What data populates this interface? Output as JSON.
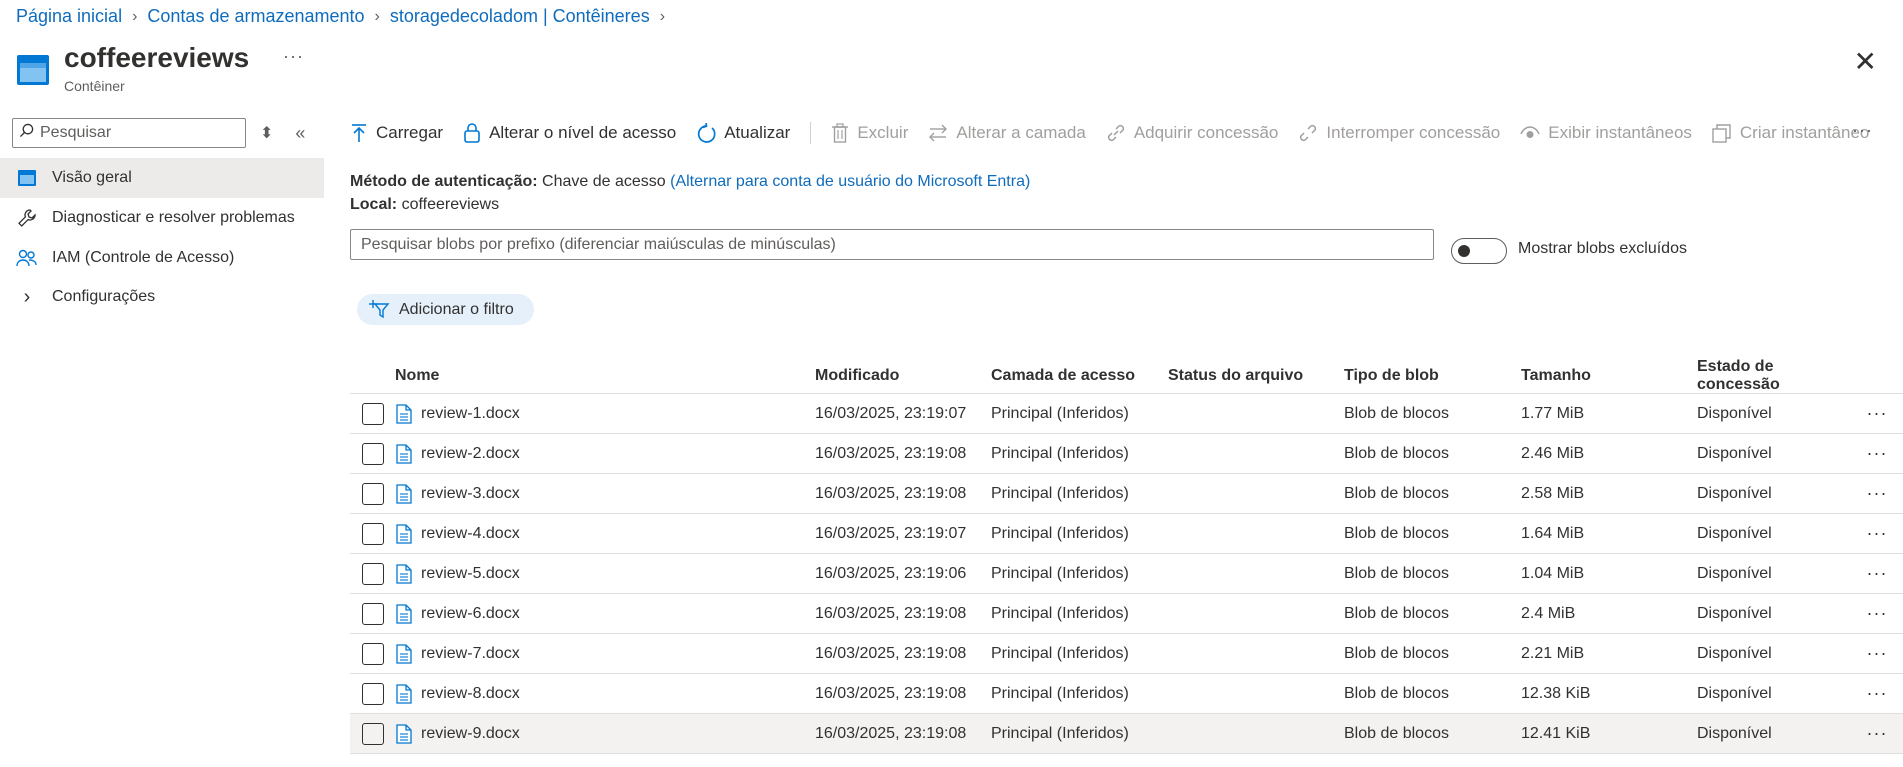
{
  "breadcrumb": [
    "Página inicial",
    "Contas de armazenamento",
    "storagedecoladom | Contêineres"
  ],
  "title": "coffeereviews",
  "subtitle": "Contêiner",
  "sidebar": {
    "search_placeholder": "Pesquisar",
    "items": [
      {
        "label": "Visão geral",
        "icon": "container-icon",
        "active": true
      },
      {
        "label": "Diagnosticar e resolver problemas",
        "icon": "wrench-icon"
      },
      {
        "label": "IAM (Controle de Acesso)",
        "icon": "people-icon"
      },
      {
        "label": "Configurações",
        "icon": "chevron-right-icon"
      }
    ]
  },
  "toolbar": {
    "upload": "Carregar",
    "access_level": "Alterar o nível de acesso",
    "refresh": "Atualizar",
    "delete": "Excluir",
    "change_tier": "Alterar a camada",
    "acquire_lease": "Adquirir concessão",
    "break_lease": "Interromper concessão",
    "view_snapshots": "Exibir instantâneos",
    "create_snapshot": "Criar instantâneo"
  },
  "auth": {
    "method_label": "Método de autenticação:",
    "method_value": "Chave de acesso",
    "method_link": "(Alternar para conta de usuário do Microsoft Entra)",
    "location_label": "Local:",
    "location_value": "coffeereviews"
  },
  "blob_search_placeholder": "Pesquisar blobs por prefixo (diferenciar maiúsculas de minúsculas)",
  "show_deleted_label": "Mostrar blobs excluídos",
  "add_filter": "Adicionar o filtro",
  "columns": [
    "Nome",
    "Modificado",
    "Camada de acesso",
    "Status do arquivo",
    "Tipo de blob",
    "Tamanho",
    "Estado de concessão"
  ],
  "rows": [
    {
      "name": "review-1.docx",
      "modified": "16/03/2025, 23:19:07",
      "tier": "Principal (Inferidos)",
      "status": "",
      "type": "Blob de blocos",
      "size": "1.77 MiB",
      "lease": "Disponível"
    },
    {
      "name": "review-2.docx",
      "modified": "16/03/2025, 23:19:08",
      "tier": "Principal (Inferidos)",
      "status": "",
      "type": "Blob de blocos",
      "size": "2.46 MiB",
      "lease": "Disponível"
    },
    {
      "name": "review-3.docx",
      "modified": "16/03/2025, 23:19:08",
      "tier": "Principal (Inferidos)",
      "status": "",
      "type": "Blob de blocos",
      "size": "2.58 MiB",
      "lease": "Disponível"
    },
    {
      "name": "review-4.docx",
      "modified": "16/03/2025, 23:19:07",
      "tier": "Principal (Inferidos)",
      "status": "",
      "type": "Blob de blocos",
      "size": "1.64 MiB",
      "lease": "Disponível"
    },
    {
      "name": "review-5.docx",
      "modified": "16/03/2025, 23:19:06",
      "tier": "Principal (Inferidos)",
      "status": "",
      "type": "Blob de blocos",
      "size": "1.04 MiB",
      "lease": "Disponível"
    },
    {
      "name": "review-6.docx",
      "modified": "16/03/2025, 23:19:08",
      "tier": "Principal (Inferidos)",
      "status": "",
      "type": "Blob de blocos",
      "size": "2.4 MiB",
      "lease": "Disponível"
    },
    {
      "name": "review-7.docx",
      "modified": "16/03/2025, 23:19:08",
      "tier": "Principal (Inferidos)",
      "status": "",
      "type": "Blob de blocos",
      "size": "2.21 MiB",
      "lease": "Disponível"
    },
    {
      "name": "review-8.docx",
      "modified": "16/03/2025, 23:19:08",
      "tier": "Principal (Inferidos)",
      "status": "",
      "type": "Blob de blocos",
      "size": "12.38 KiB",
      "lease": "Disponível"
    },
    {
      "name": "review-9.docx",
      "modified": "16/03/2025, 23:19:08",
      "tier": "Principal (Inferidos)",
      "status": "",
      "type": "Blob de blocos",
      "size": "12.41 KiB",
      "lease": "Disponível"
    }
  ],
  "colors": {
    "accent": "#0f6cbd",
    "disabled": "#a19f9d",
    "active_bg": "#edebe9"
  }
}
